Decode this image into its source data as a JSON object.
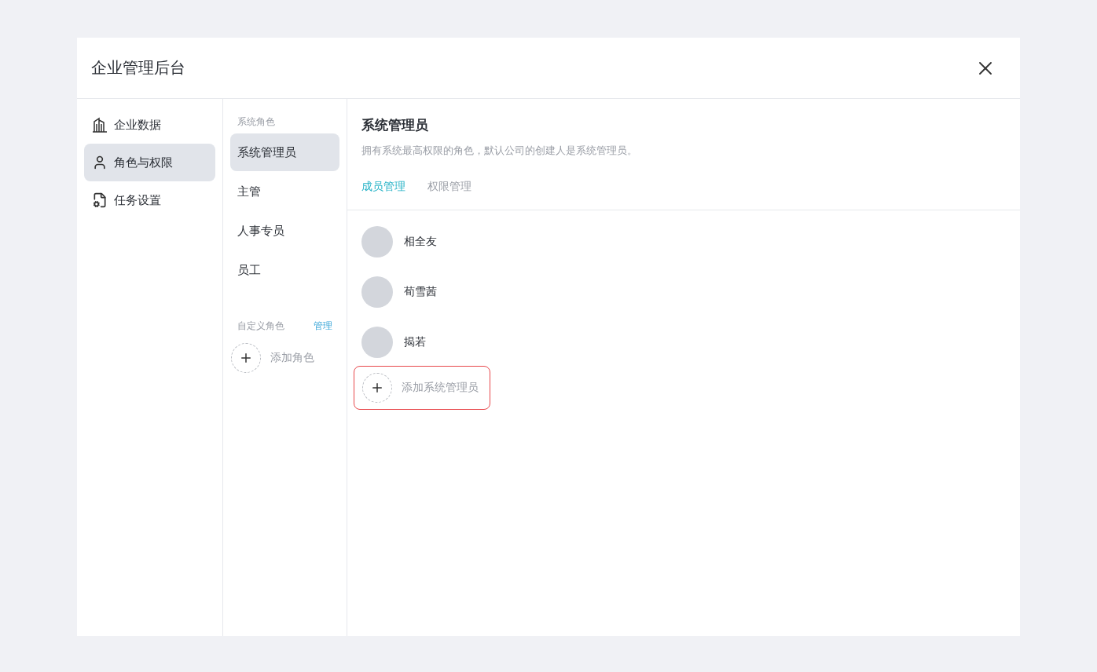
{
  "window": {
    "title": "企业管理后台"
  },
  "sidebar": {
    "items": [
      {
        "kind": "building",
        "label": "企业数据",
        "selected": false
      },
      {
        "kind": "user",
        "label": "角色与权限",
        "selected": true
      },
      {
        "kind": "task",
        "label": "任务设置",
        "selected": false
      }
    ]
  },
  "roles": {
    "system_heading": "系统角色",
    "system_roles": [
      {
        "label": "系统管理员",
        "selected": true
      },
      {
        "label": "主管",
        "selected": false
      },
      {
        "label": "人事专员",
        "selected": false
      },
      {
        "label": "员工",
        "selected": false
      }
    ],
    "custom_heading": "自定义角色",
    "manage_link": "管理",
    "add_role": "添加角色"
  },
  "detail": {
    "title": "系统管理员",
    "description": "拥有系统最高权限的角色，默认公司的创建人是系统管理员。",
    "tabs": [
      {
        "label": "成员管理",
        "selected": true
      },
      {
        "label": "权限管理",
        "selected": false
      }
    ],
    "members": [
      {
        "name": "相全友"
      },
      {
        "name": "荀雪茜"
      },
      {
        "name": "揭若"
      }
    ],
    "add_member": {
      "label": "添加系统管理员",
      "highlighted": true
    }
  }
}
